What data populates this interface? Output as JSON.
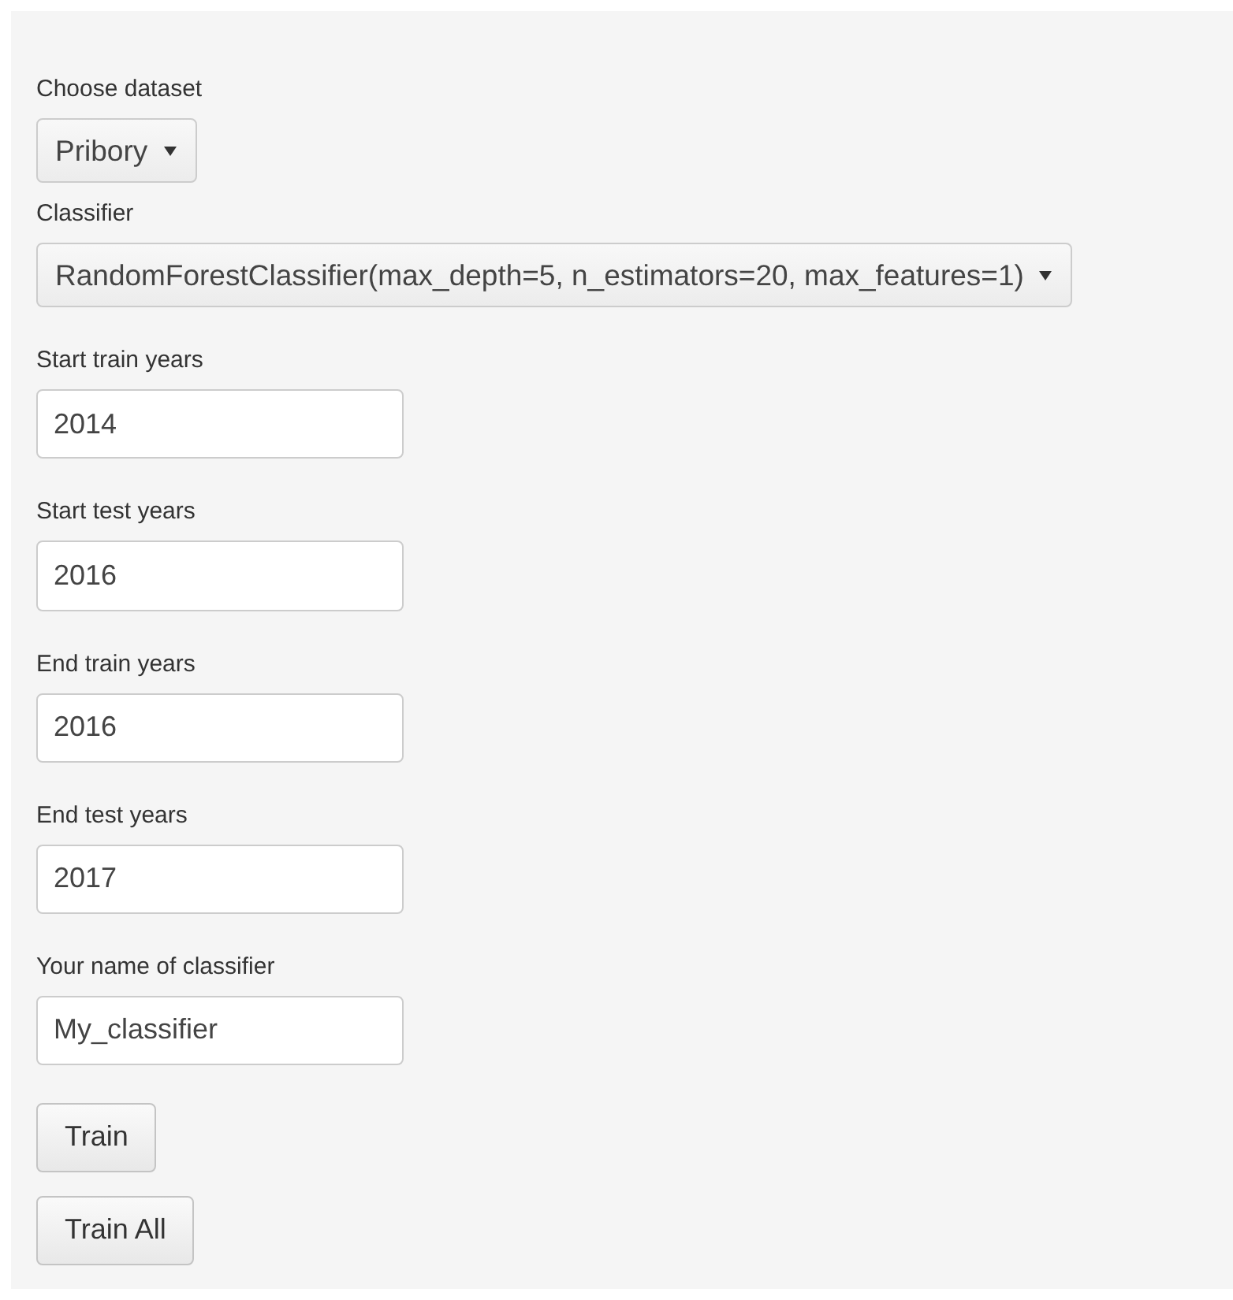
{
  "dataset": {
    "label": "Choose dataset",
    "value": "Pribory"
  },
  "classifier": {
    "label": "Classifier",
    "value": "RandomForestClassifier(max_depth=5, n_estimators=20, max_features=1)"
  },
  "fields": [
    {
      "label": "Start train years",
      "value": "2014"
    },
    {
      "label": "Start test years",
      "value": "2016"
    },
    {
      "label": "End train years",
      "value": "2016"
    },
    {
      "label": "End test years",
      "value": "2017"
    },
    {
      "label": "Your name of classifier",
      "value": "My_classifier"
    }
  ],
  "buttons": [
    "Train",
    "Train All"
  ]
}
